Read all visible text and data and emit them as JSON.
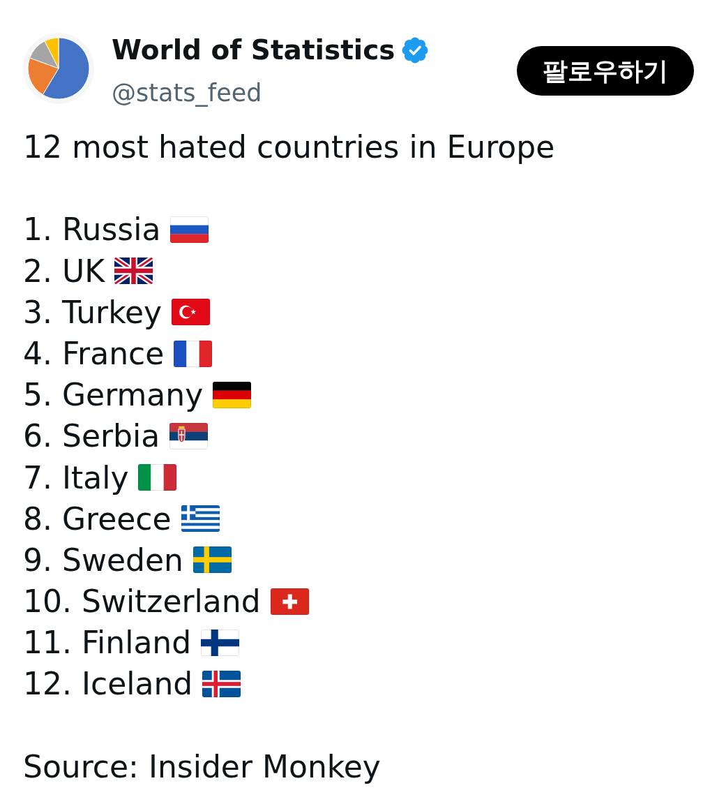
{
  "author": {
    "name": "World of Statistics",
    "verified": true,
    "handle": "@stats_feed"
  },
  "follow_button": {
    "label": "팔로우하기"
  },
  "post": {
    "text": "12 most hated countries in Europe",
    "list": [
      {
        "text": "1. Russia",
        "kind": "russia"
      },
      {
        "text": "2. UK",
        "kind": "uk"
      },
      {
        "text": "3. Turkey",
        "kind": "turkey"
      },
      {
        "text": "4. France",
        "kind": "france"
      },
      {
        "text": "5. Germany",
        "kind": "germany"
      },
      {
        "text": "6. Serbia",
        "kind": "serbia"
      },
      {
        "text": "7. Italy",
        "kind": "italy"
      },
      {
        "text": "8. Greece",
        "kind": "greece"
      },
      {
        "text": "9. Sweden",
        "kind": "sweden"
      },
      {
        "text": "10. Switzerland",
        "kind": "switzerland"
      },
      {
        "text": "11. Finland",
        "kind": "finland"
      },
      {
        "text": "12. Iceland",
        "kind": "iceland"
      }
    ],
    "source": "Source: Insider Monkey"
  }
}
